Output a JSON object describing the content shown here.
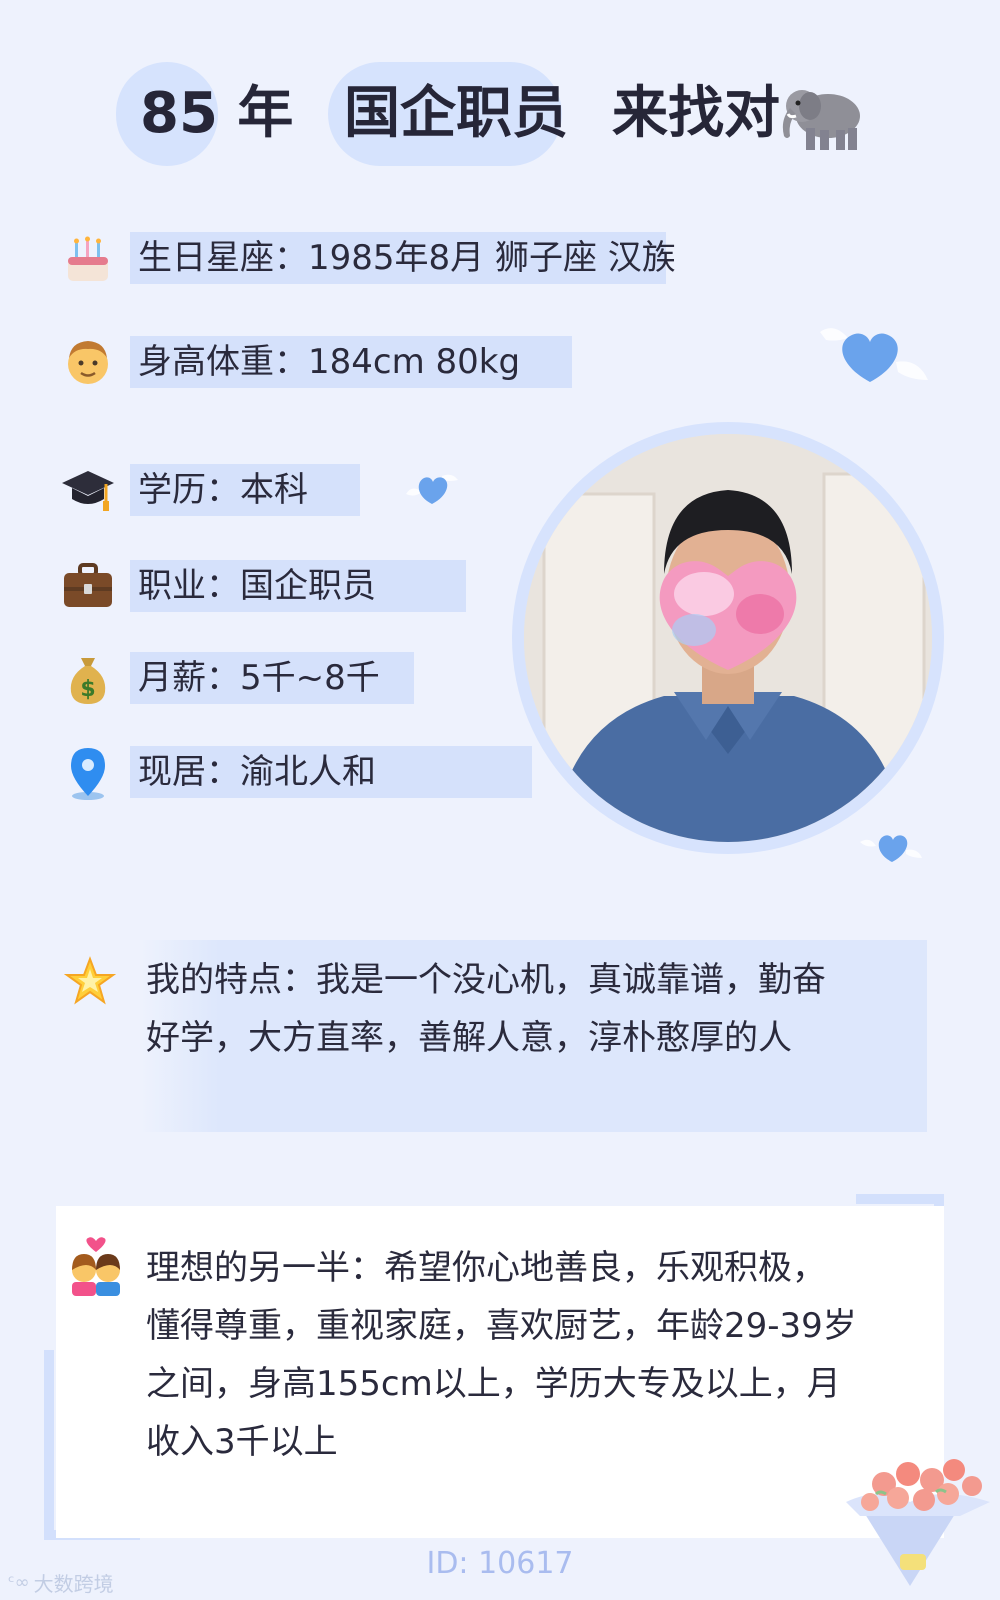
{
  "header": {
    "age": "85 年",
    "job": "国企职员",
    "tagline": "来找对",
    "tagline_icon": "elephant-icon"
  },
  "info": [
    {
      "icon": "birthday-cake-icon",
      "label": "生日星座：1985年8月 狮子座 汉族"
    },
    {
      "icon": "man-face-icon",
      "label": "身高体重：184cm 80kg"
    },
    {
      "icon": "graduation-cap-icon",
      "label": "学历：本科"
    },
    {
      "icon": "briefcase-icon",
      "label": "职业：国企职员"
    },
    {
      "icon": "money-bag-icon",
      "label": "月薪：5千~8千"
    },
    {
      "icon": "location-pin-icon",
      "label": "现居：渝北人和"
    }
  ],
  "features": {
    "icon": "sparkle-star-icon",
    "lines": [
      "我的特点：我是一个没心机，真诚靠谱，勤奋",
      "好学，大方直率，善解人意，淳朴憨厚的人"
    ]
  },
  "ideal": {
    "icon": "couple-heart-icon",
    "lines": [
      "理想的另一半：希望你心地善良，乐观积极，",
      "懂得尊重，重视家庭，喜欢厨艺，年龄29-39岁",
      "之间，身高155cm以上，学历大专及以上，月",
      "收入3千以上"
    ]
  },
  "footer": {
    "id": "ID: 10617",
    "watermark": "大数跨境"
  },
  "colors": {
    "background": "#eef2fd",
    "highlight": "#d5e1fb",
    "accent_heart": "#6aa3ec",
    "id_text": "#a9bcef"
  }
}
